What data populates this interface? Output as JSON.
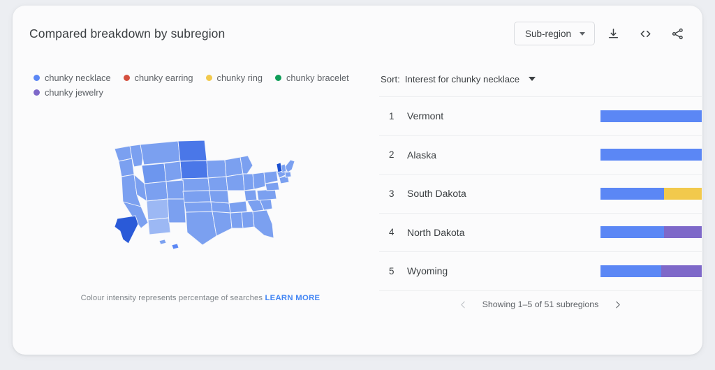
{
  "header": {
    "title": "Compared breakdown by subregion",
    "region_select_label": "Sub-region",
    "download_icon": "download-icon",
    "embed_icon": "embed-code-icon",
    "share_icon": "share-icon"
  },
  "legend": {
    "items": [
      {
        "label": "chunky necklace",
        "color": "#5b87f5"
      },
      {
        "label": "chunky earring",
        "color": "#d4503f"
      },
      {
        "label": "chunky ring",
        "color": "#f2c94c"
      },
      {
        "label": "chunky bracelet",
        "color": "#0f9d58"
      },
      {
        "label": "chunky jewelry",
        "color": "#7e68c9"
      }
    ]
  },
  "map": {
    "caption_text": "Colour intensity represents percentage of searches",
    "learn_more_label": "LEARN MORE",
    "region": "United States"
  },
  "list": {
    "sort_label": "Sort:",
    "sort_value": "Interest for chunky necklace",
    "rows": [
      {
        "rank": "1",
        "name": "Vermont",
        "segments": [
          {
            "term": "chunky necklace",
            "color": "#5b87f5",
            "percent": 100
          }
        ]
      },
      {
        "rank": "2",
        "name": "Alaska",
        "segments": [
          {
            "term": "chunky necklace",
            "color": "#5b87f5",
            "percent": 100
          }
        ]
      },
      {
        "rank": "3",
        "name": "South Dakota",
        "segments": [
          {
            "term": "chunky necklace",
            "color": "#5b87f5",
            "percent": 63
          },
          {
            "term": "chunky ring",
            "color": "#f2c94c",
            "percent": 37
          }
        ]
      },
      {
        "rank": "4",
        "name": "North Dakota",
        "segments": [
          {
            "term": "chunky necklace",
            "color": "#5b87f5",
            "percent": 63
          },
          {
            "term": "chunky jewelry",
            "color": "#7e68c9",
            "percent": 37
          }
        ]
      },
      {
        "rank": "5",
        "name": "Wyoming",
        "segments": [
          {
            "term": "chunky necklace",
            "color": "#5b87f5",
            "percent": 60
          },
          {
            "term": "chunky jewelry",
            "color": "#7e68c9",
            "percent": 40
          }
        ]
      }
    ]
  },
  "pagination": {
    "prev_icon": "chevron-left-icon",
    "next_icon": "chevron-right-icon",
    "status_text": "Showing 1–5 of 51 subregions"
  },
  "colors": {
    "accent_blue": "#4285f4",
    "card_background": "#fbfbfc",
    "page_background": "#eceef2",
    "text_primary": "#3c4043",
    "text_secondary": "#5f6368"
  }
}
